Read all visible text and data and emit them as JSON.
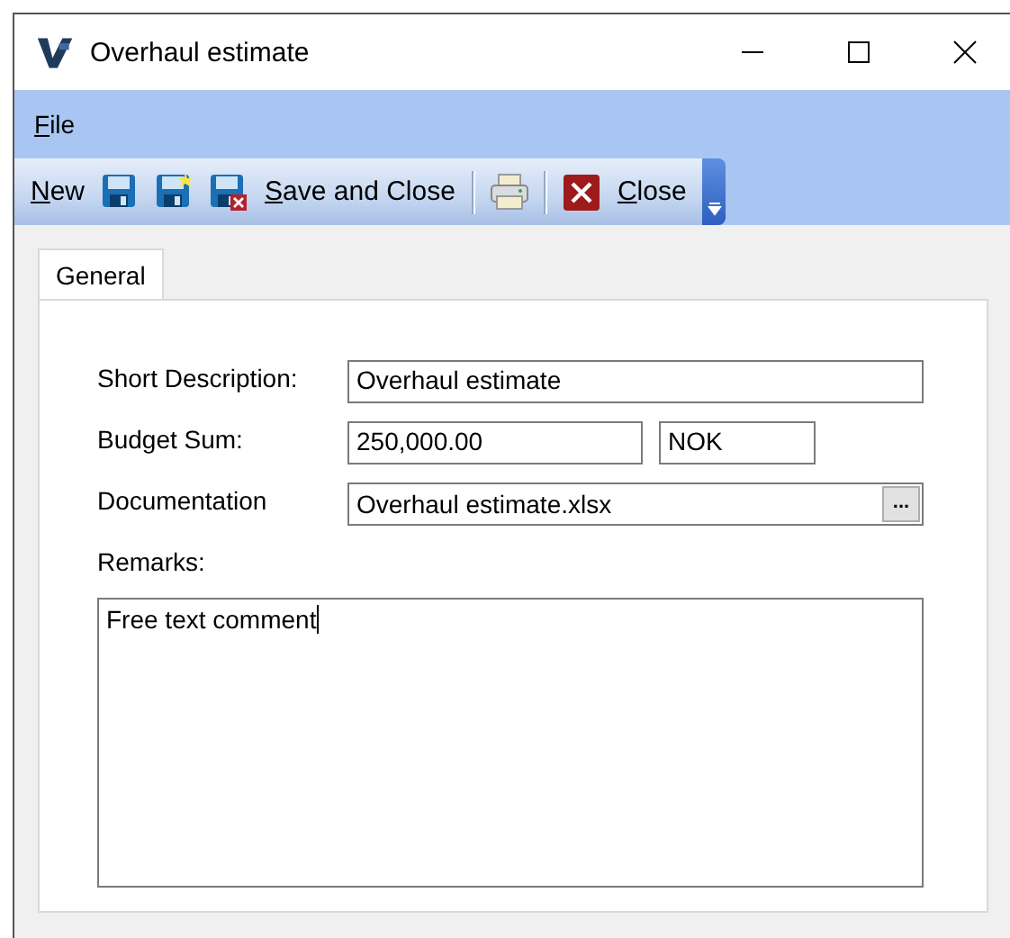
{
  "window": {
    "title": "Overhaul estimate"
  },
  "menu": [
    {
      "label": "File",
      "mnemonic_underlined": true
    }
  ],
  "toolbar": [
    {
      "kind": "text",
      "label": "New",
      "mnemonic_underlined": true
    },
    {
      "kind": "save"
    },
    {
      "kind": "save-new"
    },
    {
      "kind": "save-close"
    },
    {
      "kind": "text",
      "label": "Save and Close",
      "mnemonic_underlined": true
    },
    {
      "kind": "separator"
    },
    {
      "kind": "print"
    },
    {
      "kind": "separator"
    },
    {
      "kind": "close-icon"
    },
    {
      "kind": "text",
      "label": "Close",
      "mnemonic_underlined": true
    }
  ],
  "tabs": [
    {
      "label": "General",
      "selected": true
    }
  ],
  "form": {
    "short_description": {
      "label": "Short Description:",
      "value": "Overhaul estimate"
    },
    "budget_sum": {
      "label": "Budget Sum:",
      "value": "250,000.00",
      "currency": "NOK"
    },
    "documentation": {
      "label": "Documentation",
      "value": "Overhaul estimate.xlsx",
      "browse": "..."
    },
    "remarks": {
      "label": "Remarks:",
      "value": "Free text comment"
    }
  }
}
